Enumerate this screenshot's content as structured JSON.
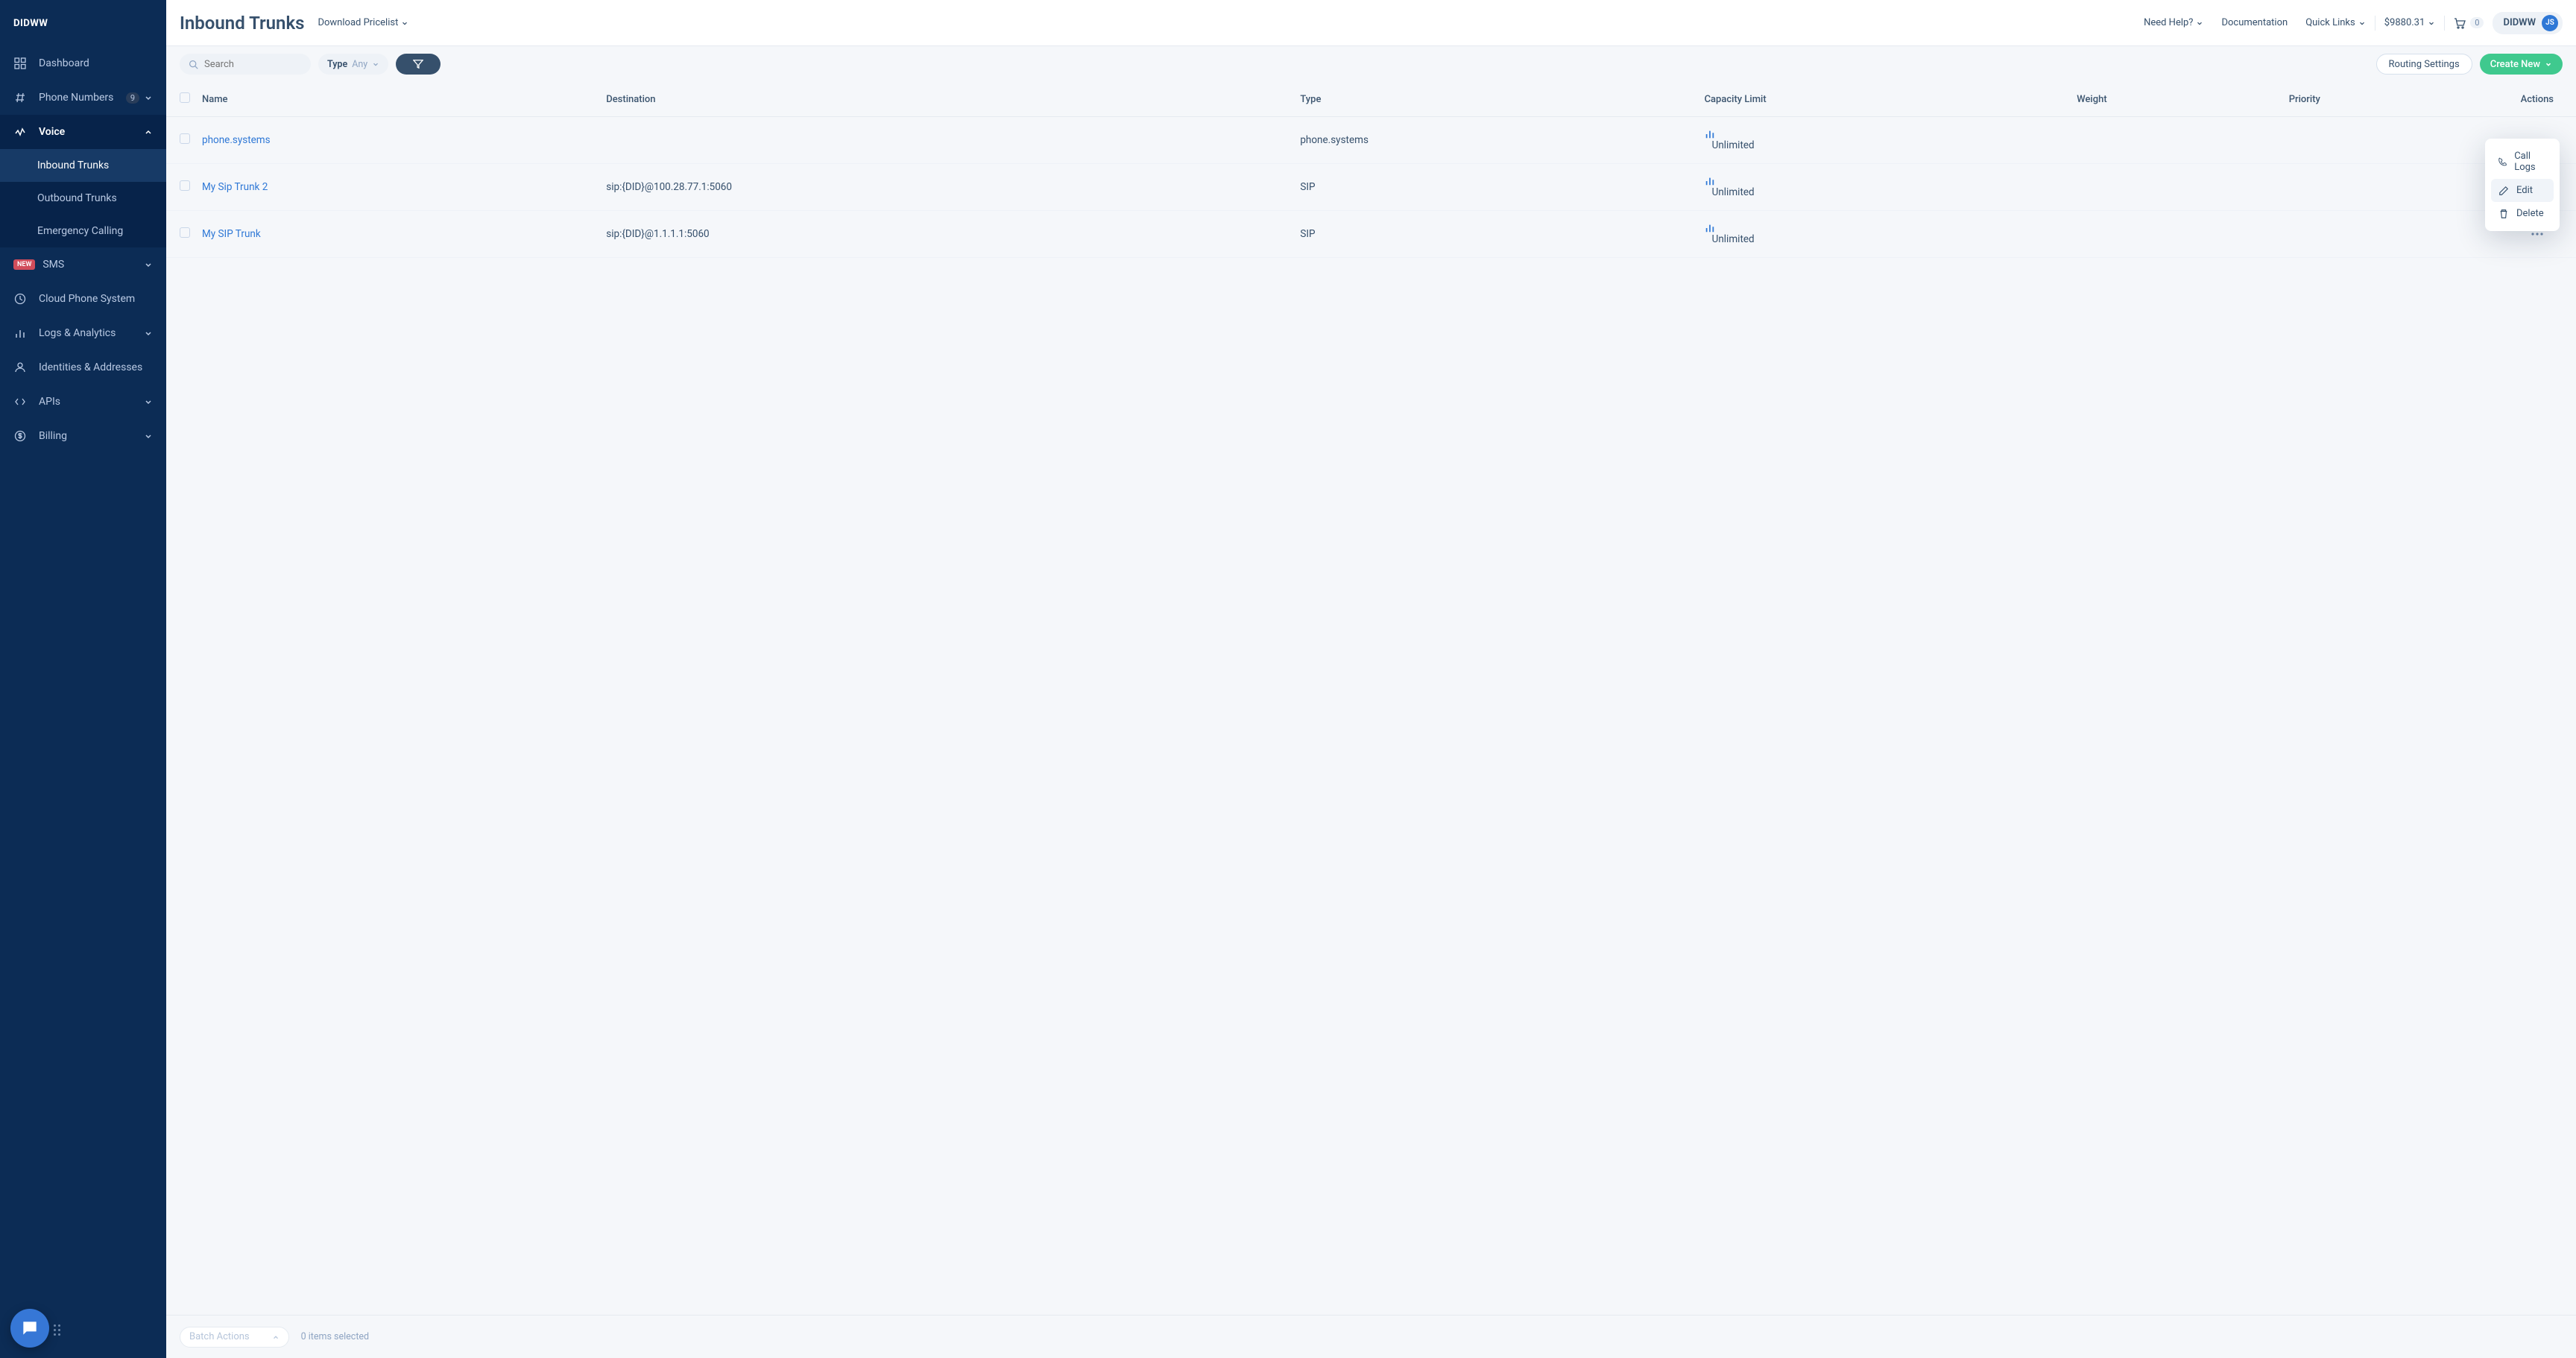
{
  "brand": "DIDWW",
  "sidebar": {
    "items": [
      {
        "label": "Dashboard"
      },
      {
        "label": "Phone Numbers",
        "badge": "9"
      },
      {
        "label": "Voice"
      },
      {
        "label": "SMS",
        "new": "NEW"
      },
      {
        "label": "Cloud Phone System"
      },
      {
        "label": "Logs & Analytics"
      },
      {
        "label": "Identities & Addresses"
      },
      {
        "label": "APIs"
      },
      {
        "label": "Billing"
      }
    ],
    "voice_sub": [
      {
        "label": "Inbound Trunks"
      },
      {
        "label": "Outbound Trunks"
      },
      {
        "label": "Emergency Calling"
      }
    ]
  },
  "topbar": {
    "title": "Inbound Trunks",
    "download_pricelist": "Download Pricelist",
    "need_help": "Need Help?",
    "documentation": "Documentation",
    "quick_links": "Quick Links",
    "balance": "$9880.31",
    "cart_count": "0",
    "account_name": "DIDWW",
    "account_avatar": "JS"
  },
  "toolbar": {
    "search_placeholder": "Search",
    "type_label": "Type",
    "type_value": "Any",
    "routing_settings": "Routing Settings",
    "create_new": "Create New"
  },
  "table": {
    "columns": [
      "Name",
      "Destination",
      "Type",
      "Capacity Limit",
      "Weight",
      "Priority",
      "Actions"
    ],
    "rows": [
      {
        "name": "phone.systems",
        "destination": "",
        "type": "phone.systems",
        "capacity": "Unlimited",
        "weight": "",
        "priority": ""
      },
      {
        "name": "My Sip Trunk 2",
        "destination": "sip:{DID}@100.28.77.1:5060",
        "type": "SIP",
        "capacity": "Unlimited",
        "weight": "",
        "priority": ""
      },
      {
        "name": "My SIP Trunk",
        "destination": "sip:{DID}@1.1.1.1:5060",
        "type": "SIP",
        "capacity": "Unlimited",
        "weight": "",
        "priority": ""
      }
    ]
  },
  "dropdown": {
    "call_logs": "Call Logs",
    "edit": "Edit",
    "delete": "Delete"
  },
  "footer": {
    "batch_actions": "Batch Actions",
    "selected": "0 items selected"
  }
}
